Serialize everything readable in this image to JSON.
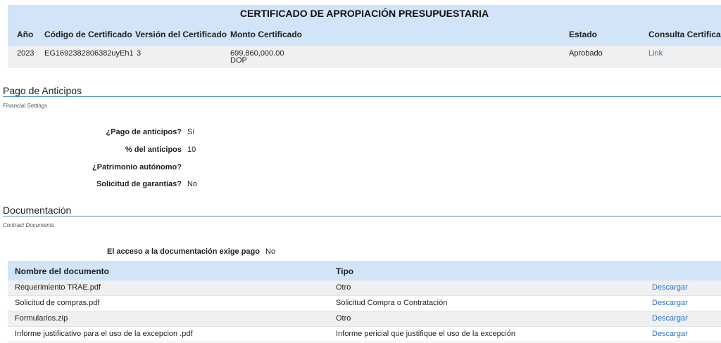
{
  "certificate": {
    "title": "CERTIFICADO DE APROPIACIÓN PRESUPUESTARIA",
    "headers": {
      "year": "Año",
      "code": "Código de Certificado",
      "version": "Versión del Certificado",
      "amount": "Monto Certificado",
      "status": "Estado",
      "query": "Consulta Certificado"
    },
    "row": {
      "year": "2023",
      "code": "EG1692382806382uyEh1",
      "version": "3",
      "amount": "699,860,000.00",
      "currency": "DOP",
      "status": "Aprobado",
      "link": "Link"
    }
  },
  "advance_payment": {
    "title": "Pago de Anticipos",
    "subtitle": "Financial Settings",
    "fields": [
      {
        "label": "¿Pago de anticipos?",
        "value": "Sí"
      },
      {
        "label": "% del anticipos",
        "value": "10"
      },
      {
        "label": "¿Patrimonio autónomo?",
        "value": ""
      },
      {
        "label": "Solicitud de garantías?",
        "value": "No"
      }
    ]
  },
  "documentation": {
    "title": "Documentación",
    "subtitle": "Contract Documents",
    "access_label": "El acceso a la documentación exige pago",
    "access_value": "No",
    "headers": {
      "name": "Nombre del documento",
      "type": "Tipo"
    },
    "download_label": "Descargar",
    "rows": [
      {
        "name": "Requerimiento TRAE.pdf",
        "type": "Otro"
      },
      {
        "name": "Solicitud de compras.pdf",
        "type": "Solicitud Compra o Contratación"
      },
      {
        "name": "Formularios.zip",
        "type": "Otro"
      },
      {
        "name": "Informe justificativo para el uso de la excepcion .pdf",
        "type": "Informe pericial que justifique el uso de la excepción"
      }
    ]
  },
  "colors": {
    "header_bg": "#d2e4f7",
    "row_alt_bg": "#eef0f2",
    "link": "#2b74c7",
    "rule": "#4a8ed4"
  }
}
